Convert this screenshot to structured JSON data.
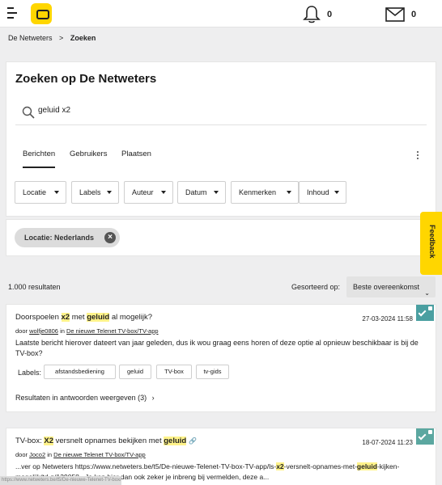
{
  "header": {
    "notifications_count": "0",
    "messages_count": "0"
  },
  "breadcrumb": {
    "home": "De Netweters",
    "separator": ">",
    "current": "Zoeken"
  },
  "search": {
    "title": "Zoeken op De Netweters",
    "query": "geluid x2"
  },
  "tabs": [
    {
      "label": "Berichten",
      "active": true
    },
    {
      "label": "Gebruikers",
      "active": false
    },
    {
      "label": "Plaatsen",
      "active": false
    }
  ],
  "filters": [
    "Locatie",
    "Labels",
    "Auteur",
    "Datum",
    "Kenmerken",
    "Inhoud"
  ],
  "active_filter": {
    "label": "Locatie: Nederlands"
  },
  "feedback_label": "Feedback",
  "results": {
    "count": "1.000 resultaten",
    "sort_label": "Gesorteerd op:",
    "sort_value": "Beste overeenkomst"
  },
  "posts": [
    {
      "title_pre": "Doorspoelen ",
      "title_hl1": "x2",
      "title_mid": " met ",
      "title_hl2": "geluid",
      "title_post": " al mogelijk?",
      "date": "27-03-2024 11:58",
      "author_prefix": "door",
      "author": "wolfje0806",
      "in": "in",
      "board": "De nieuwe Telenet TV-box/TV-app",
      "body": "Laatste bericht hierover dateert van jaar geleden, dus ik wou graag eens horen of deze optie al opnieuw beschikbaar is bij de TV-box?",
      "labels_title": "Labels:",
      "labels": [
        "afstandsbediening",
        "geluid",
        "TV-box",
        "tv-gids"
      ],
      "replies_link": "Resultaten in antwoorden weergeven (3)",
      "solved": true
    },
    {
      "title_pre": "TV-box: ",
      "title_hl1": "X2",
      "title_mid": " versnelt opnames bekijken met ",
      "title_hl2": "geluid",
      "title_post": "",
      "date": "18-07-2024 11:23",
      "author_prefix": "door",
      "author": "Joco2",
      "in": "in",
      "board": "De nieuwe Telenet TV-box/TV-app",
      "body_pre": "...ver op Netweters https://www.netweters.be/t5/De-nieuwe-Telenet-TV-box-TV-app/ls-",
      "body_hl1": "x2",
      "body_mid": "-versnelt-opnames-met-",
      "body_hl2": "geluid",
      "body_post": "-kijken-mogelijk/td-p/139058 . Je kan hier dan ook zeker je inbreng bij vermelden, deze a...",
      "solved": true
    }
  ],
  "status_bar_url": "https://www.netweters.be/t5/De-nieuwe-Telenet-TV-box/..."
}
